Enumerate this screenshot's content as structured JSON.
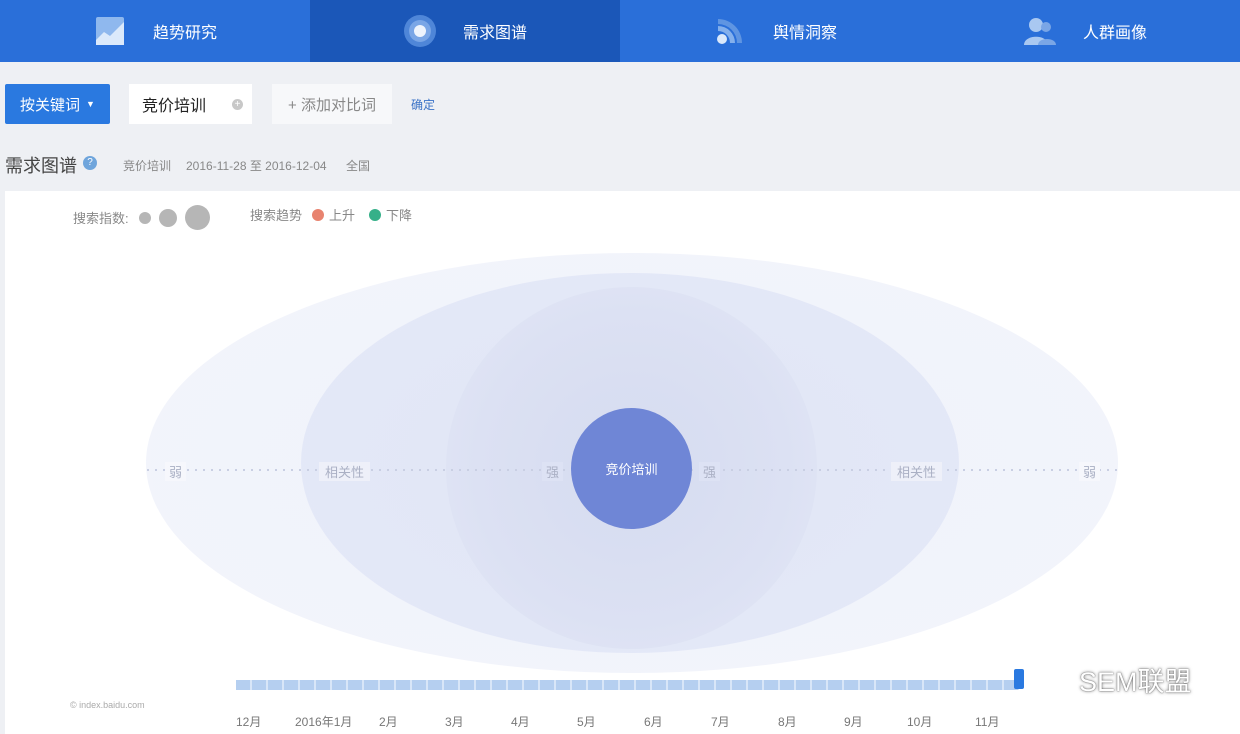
{
  "nav": {
    "tabs": [
      {
        "label": "趋势研究",
        "icon": "chart-area-icon",
        "active": false
      },
      {
        "label": "需求图谱",
        "icon": "target-icon",
        "active": true
      },
      {
        "label": "舆情洞察",
        "icon": "signal-icon",
        "active": false
      },
      {
        "label": "人群画像",
        "icon": "users-icon",
        "active": false
      }
    ]
  },
  "toolbar": {
    "mode_label": "按关键词",
    "keyword": "竞价培训",
    "add_compare_label": "+ 添加对比词",
    "confirm_label": "确定"
  },
  "section": {
    "title": "需求图谱",
    "keyword": "竞价培训",
    "date_range": "2016-11-28 至 2016-12-04",
    "region": "全国"
  },
  "legend": {
    "index_label": "搜索指数:",
    "trend_label": "搜索趋势",
    "up_label": "上升",
    "down_label": "下降",
    "up_color": "#e8836f",
    "down_color": "#36b089"
  },
  "graph": {
    "center_label": "竞价培训",
    "weak_label": "弱",
    "relevance_label": "相关性",
    "strong_label": "强",
    "node_color": "#6f86d6"
  },
  "timeline": {
    "ticks": [
      "12月",
      "2016年1月",
      "2月",
      "3月",
      "4月",
      "5月",
      "6月",
      "7月",
      "8月",
      "9月",
      "10月",
      "11月"
    ],
    "source": "© index.baidu.com"
  },
  "watermark": "SEM联盟"
}
